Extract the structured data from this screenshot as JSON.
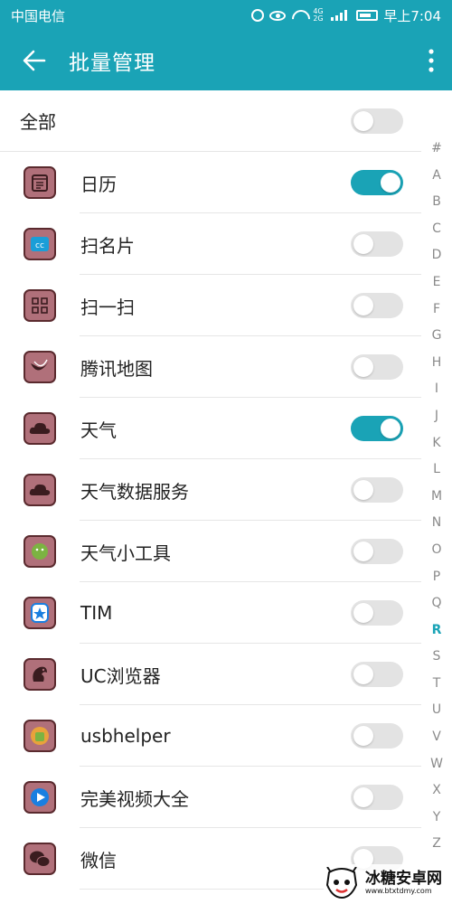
{
  "status_bar": {
    "carrier": "中国电信",
    "net_label": "4G 2G",
    "time": "早上7:04"
  },
  "title_bar": {
    "title": "批量管理",
    "back_icon": "arrow-left-icon",
    "more_icon": "more-vertical-icon"
  },
  "select_all": {
    "label": "全部",
    "enabled": false
  },
  "apps": [
    {
      "name": "日历",
      "icon": "calendar-icon",
      "enabled": true
    },
    {
      "name": "扫名片",
      "icon": "card-scan-icon",
      "enabled": false
    },
    {
      "name": "扫一扫",
      "icon": "qr-scan-icon",
      "enabled": false
    },
    {
      "name": "腾讯地图",
      "icon": "map-icon",
      "enabled": false
    },
    {
      "name": "天气",
      "icon": "weather-cloud-icon",
      "enabled": true
    },
    {
      "name": "天气数据服务",
      "icon": "weather-cloud-icon",
      "enabled": false
    },
    {
      "name": "天气小工具",
      "icon": "android-icon",
      "enabled": false
    },
    {
      "name": "TIM",
      "icon": "tim-star-icon",
      "enabled": false
    },
    {
      "name": "UC浏览器",
      "icon": "squirrel-icon",
      "enabled": false
    },
    {
      "name": "usbhelper",
      "icon": "android-badge-icon",
      "enabled": false
    },
    {
      "name": "完美视频大全",
      "icon": "play-icon",
      "enabled": false
    },
    {
      "name": "微信",
      "icon": "wechat-icon",
      "enabled": false
    }
  ],
  "index_letters": [
    "#",
    "A",
    "B",
    "C",
    "D",
    "E",
    "F",
    "G",
    "H",
    "I",
    "J",
    "K",
    "L",
    "M",
    "N",
    "O",
    "P",
    "Q",
    "R",
    "S",
    "T",
    "U",
    "V",
    "W",
    "X",
    "Y",
    "Z"
  ],
  "index_active": "R",
  "watermark": {
    "main": "冰糖安卓网",
    "sub": "www.btxtdmy.com"
  },
  "colors": {
    "accent": "#1aa3b6",
    "toggle_off": "#e3e3e3",
    "icon_fill": "#b0707a",
    "icon_border": "#5a2a2e"
  }
}
